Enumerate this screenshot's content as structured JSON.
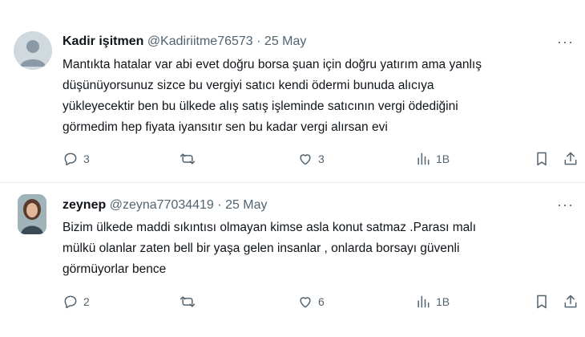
{
  "tweets": [
    {
      "name": "Kadir işitmen",
      "handle": "@Kadiriitme76573",
      "dot": "·",
      "date": "25 May",
      "more": "···",
      "lines": [
        "Mantıkta hatalar var abi evet doğru borsa şuan için doğru yatırım ama yanlış",
        "düşünüyorsunuz sizce bu vergiyi satıcı kendi ödermi bunuda alıcıya",
        "yükleyecektir ben bu ülkede alış satış işleminde satıcının vergi ödediğini",
        "görmedim hep fiyata iyansıtır sen bu kadar vergi alırsan evi"
      ],
      "replies": "3",
      "reposts": "",
      "likes": "3",
      "views": "1B"
    },
    {
      "name": "zeynep",
      "handle": "@zeyna77034419",
      "dot": "·",
      "date": "25 May",
      "more": "···",
      "lines": [
        "Bizim ülkede maddi  sıkıntısı olmayan kimse asla konut satmaz .Parası  malı",
        "mülkü olanlar zaten bell bir yaşa gelen insanlar , onlarda borsayı güvenli",
        "görmüyorlar bence"
      ],
      "replies": "2",
      "reposts": "",
      "likes": "6",
      "views": "1B"
    }
  ],
  "icons": [
    "reply-icon",
    "repost-icon",
    "like-icon",
    "views-icon",
    "bookmark-icon",
    "share-icon",
    "more-icon"
  ]
}
